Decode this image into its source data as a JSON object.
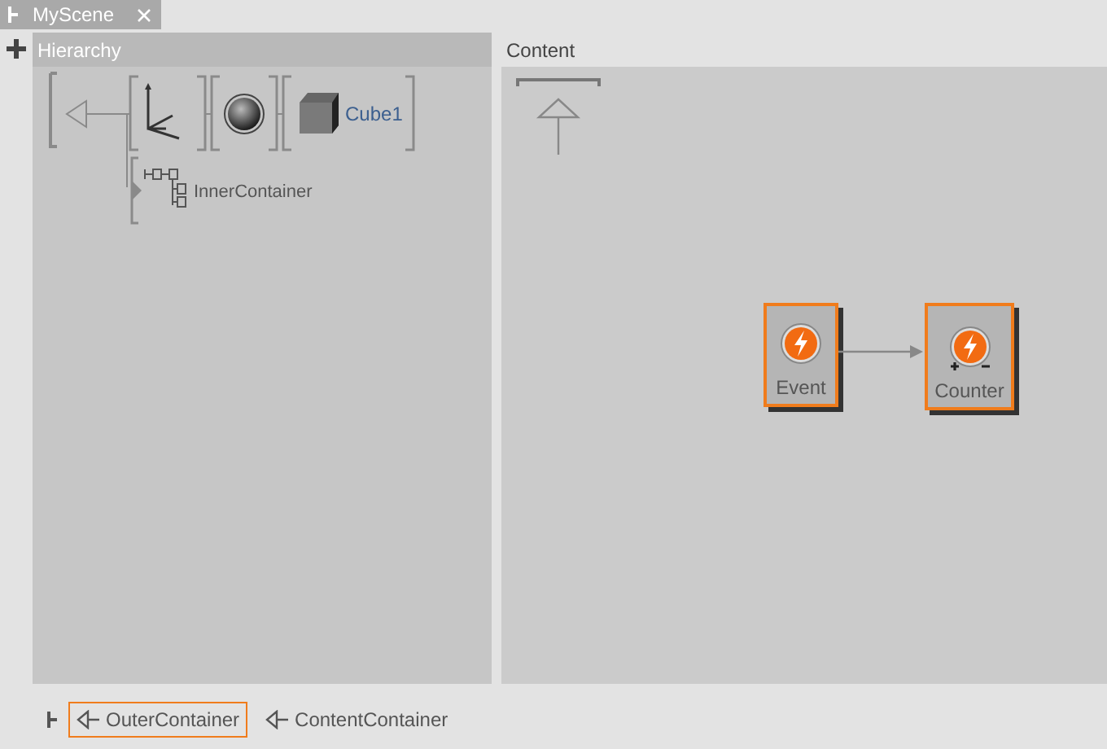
{
  "tab": {
    "title": "MyScene"
  },
  "hierarchy": {
    "title": "Hierarchy",
    "nodes": [
      {
        "kind": "axes"
      },
      {
        "kind": "sphere"
      },
      {
        "kind": "cube",
        "label": "Cube1"
      }
    ],
    "child": {
      "label": "InnerContainer"
    }
  },
  "content": {
    "title": "Content",
    "nodes": [
      {
        "kind": "event",
        "label": "Event"
      },
      {
        "kind": "counter",
        "label": "Counter"
      }
    ]
  },
  "breadcrumbs": [
    {
      "label": "OuterContainer",
      "selected": true
    },
    {
      "label": "ContentContainer",
      "selected": false
    }
  ]
}
